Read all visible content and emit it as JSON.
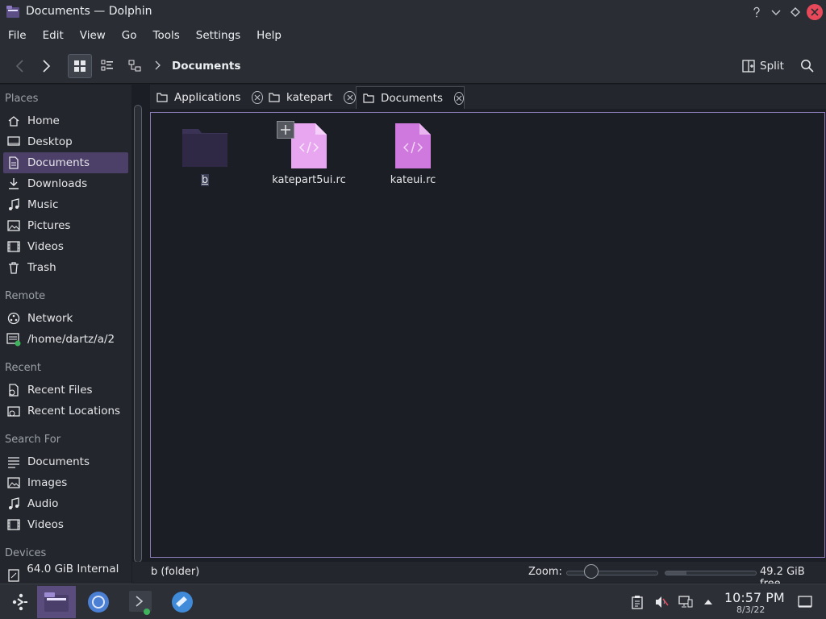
{
  "window": {
    "title": "Documents — Dolphin"
  },
  "menu": [
    "File",
    "Edit",
    "View",
    "Go",
    "Tools",
    "Settings",
    "Help"
  ],
  "toolbar": {
    "breadcrumb": "Documents",
    "split_label": "Split"
  },
  "sidebar": {
    "sections": [
      {
        "title": "Places",
        "items": [
          {
            "label": "Home",
            "icon": "home-icon"
          },
          {
            "label": "Desktop",
            "icon": "desktop-icon"
          },
          {
            "label": "Documents",
            "icon": "documents-icon",
            "active": true
          },
          {
            "label": "Downloads",
            "icon": "download-icon"
          },
          {
            "label": "Music",
            "icon": "music-icon"
          },
          {
            "label": "Pictures",
            "icon": "pictures-icon"
          },
          {
            "label": "Videos",
            "icon": "videos-icon"
          },
          {
            "label": "Trash",
            "icon": "trash-icon"
          }
        ]
      },
      {
        "title": "Remote",
        "items": [
          {
            "label": "Network",
            "icon": "network-icon"
          },
          {
            "label": "/home/dartz/a/2",
            "icon": "remote-folder-icon"
          }
        ]
      },
      {
        "title": "Recent",
        "items": [
          {
            "label": "Recent Files",
            "icon": "recent-files-icon"
          },
          {
            "label": "Recent Locations",
            "icon": "recent-locations-icon"
          }
        ]
      },
      {
        "title": "Search For",
        "items": [
          {
            "label": "Documents",
            "icon": "search-documents-icon"
          },
          {
            "label": "Images",
            "icon": "search-images-icon"
          },
          {
            "label": "Audio",
            "icon": "search-audio-icon"
          },
          {
            "label": "Videos",
            "icon": "search-videos-icon"
          }
        ]
      },
      {
        "title": "Devices",
        "items": [
          {
            "label": "64.0 GiB Internal ...",
            "icon": "drive-icon"
          }
        ]
      }
    ]
  },
  "tabs": [
    {
      "label": "Applications"
    },
    {
      "label": "katepart"
    },
    {
      "label": "Documents",
      "active": true
    }
  ],
  "files": [
    {
      "name": "b",
      "type": "folder"
    },
    {
      "name": "katepart5ui.rc",
      "type": "code-file"
    },
    {
      "name": "kateui.rc",
      "type": "code-file"
    }
  ],
  "status": {
    "text": "b (folder)",
    "zoom_label": "Zoom:",
    "free_space": "49.2 GiB free",
    "used_fraction": 0.23
  },
  "clock": {
    "time": "10:57 PM",
    "date": "8/3/22"
  },
  "colors": {
    "accent": "#8a7ab8",
    "selection": "#4c3f68",
    "file_pink": "#d98ee6"
  }
}
